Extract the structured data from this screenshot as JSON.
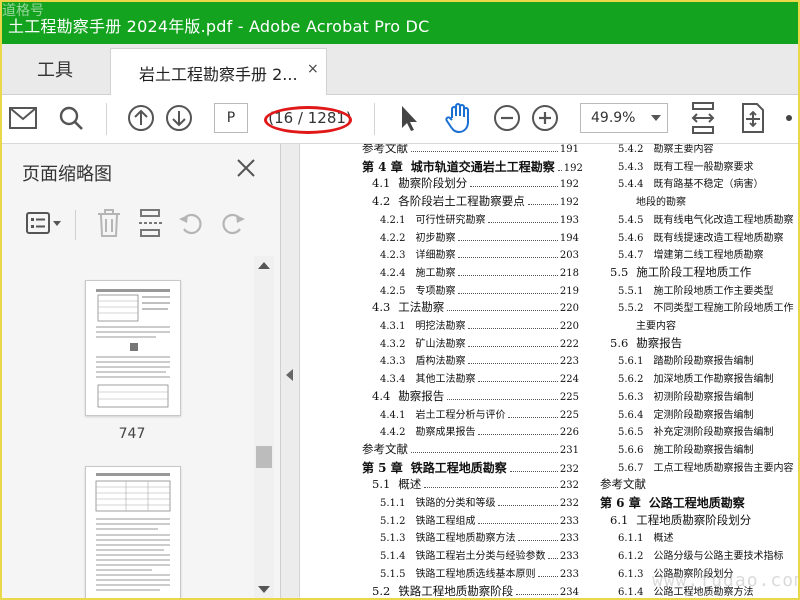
{
  "window": {
    "title": "土工程勘察手册 2024年版.pdf - Adobe Acrobat Pro DC",
    "watermark": "道格号"
  },
  "tabs": {
    "tools_label": "工具",
    "doc_label": "岩土工程勘察手册 2...",
    "close_glyph": "×"
  },
  "toolbar": {
    "page_input": "P",
    "page_count": "(16 / 1281)",
    "zoom": "49.9%"
  },
  "left_panel": {
    "title": "页面缩略图",
    "thumbnail_label": "747"
  },
  "toc_left": [
    {
      "level": "ref",
      "num": "",
      "text": "参考文献",
      "page": "191"
    },
    {
      "level": "lv1",
      "num": "第 4 章",
      "text": "城市轨道交通岩土工程勘察",
      "page": "192"
    },
    {
      "level": "lv2",
      "num": "4.1",
      "text": "勘察阶段划分",
      "page": "192"
    },
    {
      "level": "lv2",
      "num": "4.2",
      "text": "各阶段岩土工程勘察要点",
      "page": "192"
    },
    {
      "level": "lv3",
      "num": "4.2.1",
      "text": "可行性研究勘察",
      "page": "193"
    },
    {
      "level": "lv3",
      "num": "4.2.2",
      "text": "初步勘察",
      "page": "194"
    },
    {
      "level": "lv3",
      "num": "4.2.3",
      "text": "详细勘察",
      "page": "203"
    },
    {
      "level": "lv3",
      "num": "4.2.4",
      "text": "施工勘察",
      "page": "218"
    },
    {
      "level": "lv3",
      "num": "4.2.5",
      "text": "专项勘察",
      "page": "219"
    },
    {
      "level": "lv2",
      "num": "4.3",
      "text": "工法勘察",
      "page": "220"
    },
    {
      "level": "lv3",
      "num": "4.3.1",
      "text": "明挖法勘察",
      "page": "220"
    },
    {
      "level": "lv3",
      "num": "4.3.2",
      "text": "矿山法勘察",
      "page": "222"
    },
    {
      "level": "lv3",
      "num": "4.3.3",
      "text": "盾构法勘察",
      "page": "223"
    },
    {
      "level": "lv3",
      "num": "4.3.4",
      "text": "其他工法勘察",
      "page": "224"
    },
    {
      "level": "lv2",
      "num": "4.4",
      "text": "勘察报告",
      "page": "225"
    },
    {
      "level": "lv3",
      "num": "4.4.1",
      "text": "岩土工程分析与评价",
      "page": "225"
    },
    {
      "level": "lv3",
      "num": "4.4.2",
      "text": "勘察成果报告",
      "page": "226"
    },
    {
      "level": "ref",
      "num": "",
      "text": "参考文献",
      "page": "231"
    },
    {
      "level": "lv1",
      "num": "第 5 章",
      "text": "铁路工程地质勘察",
      "page": "232"
    },
    {
      "level": "lv2",
      "num": "5.1",
      "text": "概述",
      "page": "232"
    },
    {
      "level": "lv3",
      "num": "5.1.1",
      "text": "铁路的分类和等级",
      "page": "232"
    },
    {
      "level": "lv3",
      "num": "5.1.2",
      "text": "铁路工程组成",
      "page": "233"
    },
    {
      "level": "lv3",
      "num": "5.1.3",
      "text": "铁路工程地质勘察方法",
      "page": "233"
    },
    {
      "level": "lv3",
      "num": "5.1.4",
      "text": "铁路工程岩土分类与经验参数",
      "page": "233"
    },
    {
      "level": "lv3",
      "num": "5.1.5",
      "text": "铁路工程地质选线基本原则",
      "page": "233"
    },
    {
      "level": "lv2",
      "num": "5.2",
      "text": "铁路工程地质勘察阶段",
      "page": "234"
    }
  ],
  "toc_right": [
    {
      "level": "lv3",
      "num": "5.4.2",
      "text": "勘察主要内容"
    },
    {
      "level": "lv3",
      "num": "5.4.3",
      "text": "既有工程一般勘察要求"
    },
    {
      "level": "lv3",
      "num": "5.4.4",
      "text": "既有路基不稳定（病害）"
    },
    {
      "level": "lvc",
      "num": "",
      "text": "地段的勘察"
    },
    {
      "level": "lv3",
      "num": "5.4.5",
      "text": "既有线电气化改造工程地质勘察"
    },
    {
      "level": "lv3",
      "num": "5.4.6",
      "text": "既有线提速改造工程地质勘察"
    },
    {
      "level": "lv3",
      "num": "5.4.7",
      "text": "增建第二线工程地质勘察"
    },
    {
      "level": "lv2",
      "num": "5.5",
      "text": "施工阶段工程地质工作"
    },
    {
      "level": "lv3",
      "num": "5.5.1",
      "text": "施工阶段地质工作主要类型"
    },
    {
      "level": "lv3",
      "num": "5.5.2",
      "text": "不同类型工程施工阶段地质工作"
    },
    {
      "level": "lvc",
      "num": "",
      "text": "主要内容"
    },
    {
      "level": "lv2",
      "num": "5.6",
      "text": "勘察报告"
    },
    {
      "level": "lv3",
      "num": "5.6.1",
      "text": "踏勘阶段勘察报告编制"
    },
    {
      "level": "lv3",
      "num": "5.6.2",
      "text": "加深地质工作勘察报告编制"
    },
    {
      "level": "lv3",
      "num": "5.6.3",
      "text": "初测阶段勘察报告编制"
    },
    {
      "level": "lv3",
      "num": "5.6.4",
      "text": "定测阶段勘察报告编制"
    },
    {
      "level": "lv3",
      "num": "5.6.5",
      "text": "补充定测阶段勘察报告编制"
    },
    {
      "level": "lv3",
      "num": "5.6.6",
      "text": "施工阶段勘察报告编制"
    },
    {
      "level": "lv3",
      "num": "5.6.7",
      "text": "工点工程地质勘察报告主要内容"
    },
    {
      "level": "ref",
      "num": "",
      "text": "参考文献"
    },
    {
      "level": "lv1",
      "num": "第 6 章",
      "text": "公路工程地质勘察"
    },
    {
      "level": "lv2",
      "num": "6.1",
      "text": "工程地质勘察阶段划分"
    },
    {
      "level": "lv3",
      "num": "6.1.1",
      "text": "概述"
    },
    {
      "level": "lv3",
      "num": "6.1.2",
      "text": "公路分级与公路主要技术指标"
    },
    {
      "level": "lv3",
      "num": "6.1.3",
      "text": "公路勘察阶段划分"
    },
    {
      "level": "lv3",
      "num": "6.1.4",
      "text": "公路工程地质勘察方法"
    }
  ],
  "doc_watermark": "www.fudao.com",
  "accent": "#14a31f",
  "highlight": "#e01818"
}
